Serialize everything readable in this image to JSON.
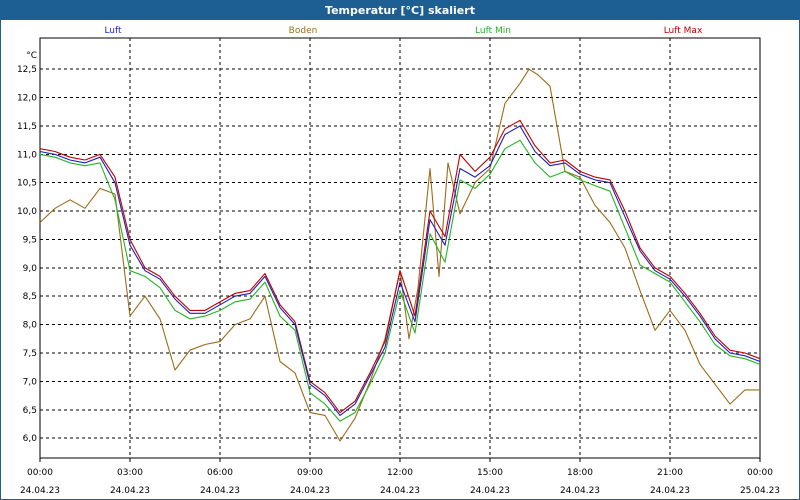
{
  "window": {
    "title": "Temperatur [°C] skaliert"
  },
  "chart_data": {
    "type": "line",
    "title": "Temperatur [°C] skaliert",
    "xlabel": "",
    "ylabel": "",
    "unit": "°C",
    "ylim": [
      5.65,
      13.05
    ],
    "yticks": [
      "6,0",
      "6,5",
      "7,0",
      "7,5",
      "8,0",
      "8,5",
      "9,0",
      "9,5",
      "10,0",
      "10,5",
      "11,0",
      "11,5",
      "12,0",
      "12,5"
    ],
    "xlim": [
      0,
      24
    ],
    "xticks": [
      {
        "time": "00:00",
        "date": "24.04.23"
      },
      {
        "time": "03:00",
        "date": "24.04.23"
      },
      {
        "time": "06:00",
        "date": "24.04.23"
      },
      {
        "time": "09:00",
        "date": "24.04.23"
      },
      {
        "time": "12:00",
        "date": "24.04.23"
      },
      {
        "time": "15:00",
        "date": "24.04.23"
      },
      {
        "time": "18:00",
        "date": "24.04.23"
      },
      {
        "time": "21:00",
        "date": "24.04.23"
      },
      {
        "time": "00:00",
        "date": "25.04.23"
      }
    ],
    "grid": true,
    "legend_position": "top",
    "series": [
      {
        "name": "Luft",
        "color": "#1f1fbf",
        "x": [
          0,
          0.5,
          1,
          1.5,
          2,
          2.5,
          3,
          3.5,
          4,
          4.5,
          5,
          5.5,
          6,
          6.5,
          7,
          7.5,
          8,
          8.5,
          9,
          9.5,
          10,
          10.5,
          11,
          11.5,
          12,
          12.5,
          13,
          13.5,
          14,
          14.5,
          15,
          15.5,
          16,
          16.5,
          17,
          17.5,
          18,
          18.5,
          19,
          19.5,
          20,
          20.5,
          21,
          21.5,
          22,
          22.5,
          23,
          23.5,
          24
        ],
        "y": [
          11.05,
          11.0,
          10.9,
          10.85,
          10.95,
          10.5,
          9.4,
          8.95,
          8.8,
          8.45,
          8.2,
          8.2,
          8.35,
          8.5,
          8.55,
          8.85,
          8.3,
          8.0,
          6.95,
          6.75,
          6.4,
          6.6,
          7.1,
          7.6,
          8.75,
          8.05,
          9.85,
          9.4,
          10.75,
          10.6,
          10.8,
          11.35,
          11.5,
          11.05,
          10.8,
          10.85,
          10.65,
          10.55,
          10.5,
          9.9,
          9.3,
          8.95,
          8.8,
          8.5,
          8.15,
          7.75,
          7.5,
          7.45,
          7.35
        ]
      },
      {
        "name": "Boden",
        "color": "#9c6b1a",
        "x": [
          0,
          0.5,
          1,
          1.5,
          2,
          2.5,
          3,
          3.5,
          4,
          4.5,
          5,
          5.5,
          6,
          6.5,
          7,
          7.5,
          8,
          8.5,
          9,
          9.5,
          10,
          10.5,
          11,
          11.5,
          12,
          12.3,
          12.6,
          13,
          13.3,
          13.6,
          14,
          14.5,
          15,
          15.5,
          16,
          16.3,
          16.6,
          17,
          17.5,
          18,
          18.5,
          19,
          19.5,
          20,
          20.5,
          21,
          21.5,
          22,
          22.5,
          23,
          23.5,
          24
        ],
        "y": [
          9.8,
          10.05,
          10.2,
          10.05,
          10.4,
          10.3,
          8.15,
          8.5,
          8.1,
          7.2,
          7.55,
          7.65,
          7.7,
          8.0,
          8.1,
          8.5,
          7.35,
          7.15,
          6.45,
          6.4,
          5.95,
          6.35,
          7.0,
          7.75,
          8.95,
          7.75,
          8.65,
          10.75,
          8.85,
          10.85,
          9.95,
          10.5,
          10.75,
          11.9,
          12.25,
          12.5,
          12.4,
          12.2,
          10.7,
          10.6,
          10.1,
          9.8,
          9.35,
          8.6,
          7.9,
          8.25,
          7.9,
          7.3,
          6.95,
          6.6,
          6.85,
          6.85
        ]
      },
      {
        "name": "Luft Min",
        "color": "#22b522",
        "x": [
          0,
          0.5,
          1,
          1.5,
          2,
          2.5,
          3,
          3.5,
          4,
          4.5,
          5,
          5.5,
          6,
          6.5,
          7,
          7.5,
          8,
          8.5,
          9,
          9.5,
          10,
          10.5,
          11,
          11.5,
          12,
          12.5,
          13,
          13.5,
          14,
          14.5,
          15,
          15.5,
          16,
          16.5,
          17,
          17.5,
          18,
          18.5,
          19,
          19.5,
          20,
          20.5,
          21,
          21.5,
          22,
          22.5,
          23,
          23.5,
          24
        ],
        "y": [
          11.0,
          10.95,
          10.85,
          10.8,
          10.85,
          10.2,
          8.95,
          8.85,
          8.65,
          8.25,
          8.1,
          8.15,
          8.25,
          8.4,
          8.45,
          8.75,
          8.15,
          7.9,
          6.8,
          6.6,
          6.3,
          6.45,
          6.95,
          7.5,
          8.6,
          7.85,
          9.6,
          9.1,
          10.55,
          10.4,
          10.65,
          11.1,
          11.25,
          10.85,
          10.6,
          10.7,
          10.55,
          10.45,
          10.35,
          9.7,
          9.05,
          8.9,
          8.75,
          8.4,
          8.05,
          7.65,
          7.45,
          7.4,
          7.3
        ]
      },
      {
        "name": "Luft Max",
        "color": "#c00000",
        "x": [
          0,
          0.5,
          1,
          1.5,
          2,
          2.5,
          3,
          3.5,
          4,
          4.5,
          5,
          5.5,
          6,
          6.5,
          7,
          7.5,
          8,
          8.5,
          9,
          9.5,
          10,
          10.5,
          11,
          11.5,
          12,
          12.5,
          13,
          13.5,
          14,
          14.5,
          15,
          15.5,
          16,
          16.5,
          17,
          17.5,
          18,
          18.5,
          19,
          19.5,
          20,
          20.5,
          21,
          21.5,
          22,
          22.5,
          23,
          23.5,
          24
        ],
        "y": [
          11.1,
          11.05,
          10.95,
          10.9,
          11.0,
          10.6,
          9.5,
          9.0,
          8.85,
          8.5,
          8.25,
          8.25,
          8.4,
          8.55,
          8.6,
          8.9,
          8.35,
          8.05,
          7.0,
          6.8,
          6.45,
          6.65,
          7.15,
          7.7,
          8.95,
          8.15,
          10.0,
          9.55,
          11.0,
          10.7,
          10.95,
          11.45,
          11.6,
          11.15,
          10.85,
          10.9,
          10.7,
          10.6,
          10.55,
          10.0,
          9.35,
          9.0,
          8.85,
          8.55,
          8.2,
          7.8,
          7.55,
          7.5,
          7.4
        ]
      }
    ]
  }
}
